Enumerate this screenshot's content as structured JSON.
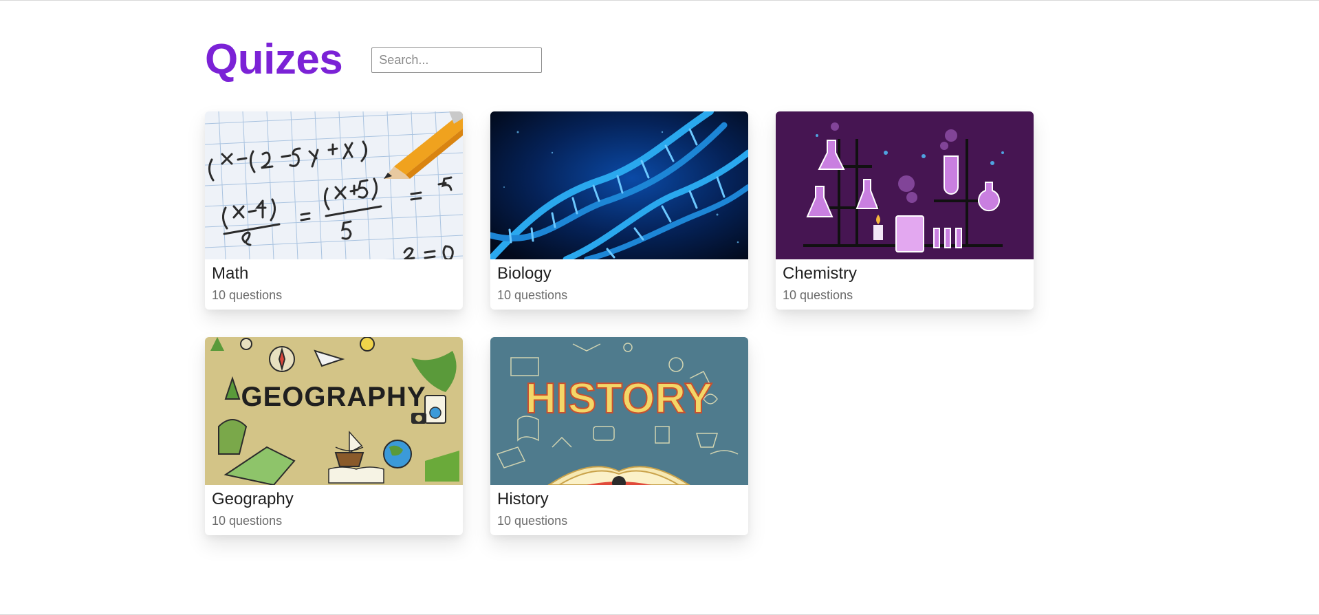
{
  "header": {
    "title": "Quizes",
    "search_placeholder": "Search..."
  },
  "quizzes": [
    {
      "title": "Math",
      "subtitle": "10 questions"
    },
    {
      "title": "Biology",
      "subtitle": "10 questions"
    },
    {
      "title": "Chemistry",
      "subtitle": "10 questions"
    },
    {
      "title": "Geography",
      "subtitle": "10 questions"
    },
    {
      "title": "History",
      "subtitle": "10 questions",
      "image_text": "HISTORY"
    }
  ],
  "colors": {
    "accent": "#7b22d6",
    "math_bg": "#eef2f8",
    "biology_bg": "#03122a",
    "chemistry_bg": "#461552",
    "geography_bg": "#d3c487",
    "history_bg": "#4f7b8d"
  }
}
